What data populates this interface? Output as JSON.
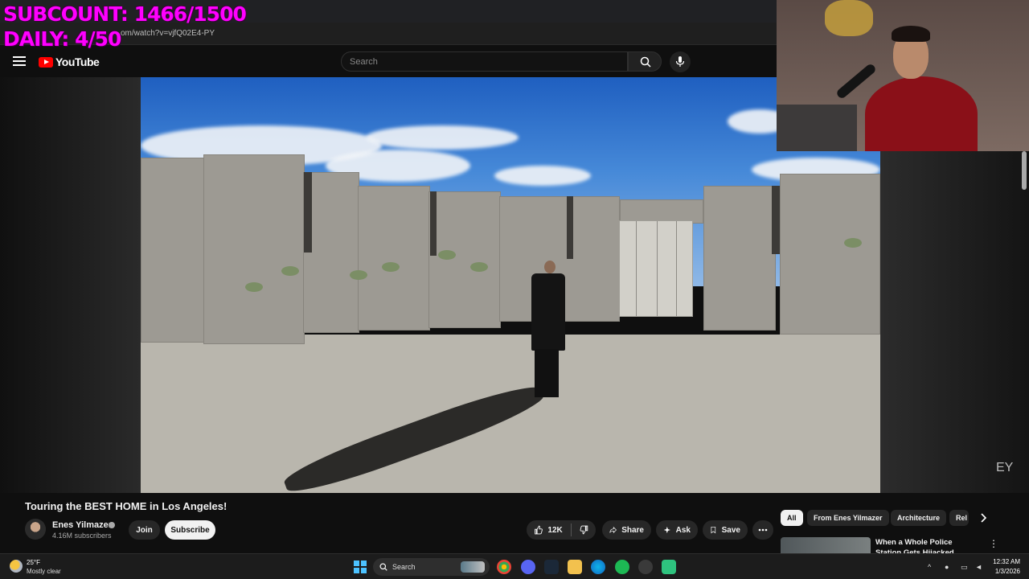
{
  "overlay": {
    "subcount": "SUBCOUNT: 1466/1500",
    "daily": "DAILY: 4/50"
  },
  "browser": {
    "url": "om/watch?v=vjfQ02E4-PY"
  },
  "header": {
    "logo_text": "YouTube",
    "search_placeholder": "Search"
  },
  "video": {
    "title": "Touring the BEST HOME in Los Angeles!",
    "watermark": "EY",
    "channel": {
      "name": "Enes Yilmazer",
      "subscribers": "4.16M subscribers"
    },
    "buttons": {
      "join": "Join",
      "subscribe": "Subscribe",
      "likes": "12K",
      "share": "Share",
      "ask": "Ask",
      "save": "Save"
    }
  },
  "chips": [
    "All",
    "From Enes Yilmazer",
    "Architecture",
    "Rel"
  ],
  "recommended": {
    "title": "When a Whole Police Station Gets Hijacked"
  },
  "taskbar": {
    "temperature": "25°F",
    "condition": "Mostly clear",
    "search_label": "Search",
    "time": "12:32 AM",
    "date": "1/3/2026"
  },
  "colors": {
    "accent_overlay": "#ff00ff",
    "youtube_red": "#ff0000",
    "background": "#0f0f0f"
  }
}
